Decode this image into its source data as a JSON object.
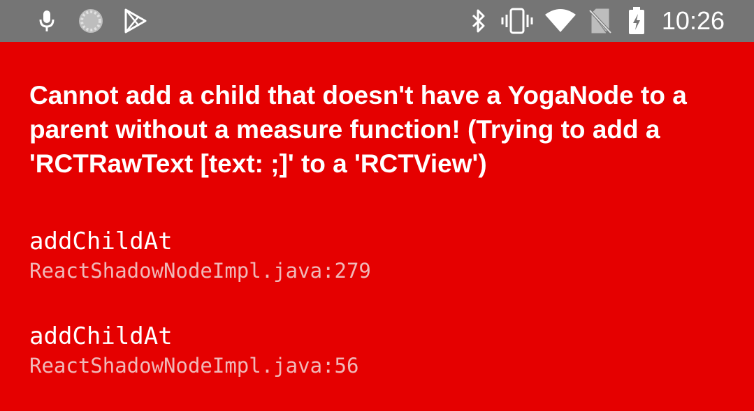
{
  "status_bar": {
    "time": "10:26",
    "left_icons": [
      "microphone-icon",
      "loading-spinner-icon",
      "play-store-icon"
    ],
    "right_icons": [
      "bluetooth-icon",
      "vibrate-icon",
      "wifi-icon",
      "no-sim-icon",
      "battery-charging-icon"
    ],
    "background_color": "#757575"
  },
  "redbox": {
    "background_color": "#e50000",
    "message": "Cannot add a child that doesn't have a YogaNode to a parent without a measure function! (Trying to add a 'RCTRawText [text: ;]' to a 'RCTView')",
    "stack": [
      {
        "method": "addChildAt",
        "location": "ReactShadowNodeImpl.java:279"
      },
      {
        "method": "addChildAt",
        "location": "ReactShadowNodeImpl.java:56"
      }
    ]
  }
}
